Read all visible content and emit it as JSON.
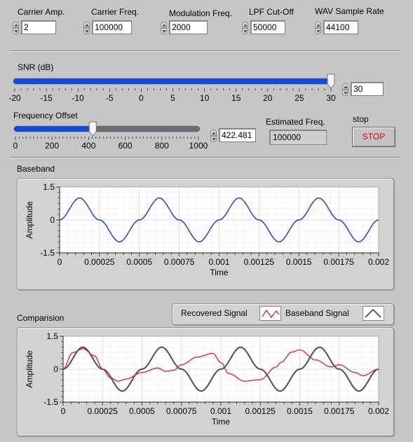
{
  "controls": {
    "carrier_amp": {
      "label": "Carrier Amp.",
      "value": "2"
    },
    "carrier_freq": {
      "label": "Carrier Freq.",
      "value": "100000"
    },
    "mod_freq": {
      "label": "Modulation Freq.",
      "value": "2000"
    },
    "lpf_cutoff": {
      "label": "LPF Cut-Off",
      "value": "50000"
    },
    "wav_rate": {
      "label": "WAV Sample Rate",
      "value": "44100"
    }
  },
  "snr": {
    "label": "SNR (dB)",
    "value": "30",
    "level": 30,
    "min": -20,
    "max": 30,
    "ticks": [
      "-20",
      "-15",
      "-10",
      "-5",
      "0",
      "5",
      "10",
      "15",
      "20",
      "25",
      "30"
    ]
  },
  "freq_offset": {
    "label": "Frequency Offset",
    "value": "422.481",
    "level": 422.481,
    "min": 0,
    "max": 1000,
    "ticks": [
      "0",
      "200",
      "400",
      "600",
      "800",
      "1000"
    ]
  },
  "estimated": {
    "label": "Estimated Freq.",
    "value": "100000"
  },
  "stop": {
    "label": "stop",
    "button": "STOP"
  },
  "colors": {
    "slider_fill": "#1747d6",
    "baseband_blue": "#1f44c8",
    "recovered_red": "#e01b1b",
    "baseband_gray": "#4d4d5c",
    "stop_red": "#e00000"
  },
  "chart_data": [
    {
      "type": "line",
      "title": "Baseband",
      "xlabel": "Time",
      "ylabel": "Amplitude",
      "xlim": [
        0,
        0.002
      ],
      "ylim": [
        -1.5,
        1.5
      ],
      "x_ticks": [
        "0",
        "0.00025",
        "0.0005",
        "0.00075",
        "0.001",
        "0.00125",
        "0.0015",
        "0.00175",
        "0.002"
      ],
      "y_ticks": [
        "1.5",
        "0",
        "-1.5"
      ],
      "grid": true,
      "series": [
        {
          "x": [
            0,
            0.000125,
            0.00025,
            0.000375,
            0.0005,
            0.000625,
            0.00075,
            0.000875,
            0.001,
            0.001125,
            0.00125,
            0.001375,
            0.0015,
            0.001625,
            0.00175,
            0.001875,
            0.002
          ],
          "values": [
            0,
            1,
            0,
            -1,
            0,
            1,
            0,
            -1,
            0,
            1,
            0,
            -1,
            0,
            1,
            0,
            -1,
            0
          ]
        }
      ]
    },
    {
      "type": "line",
      "title": "Comparision",
      "xlabel": "Time",
      "ylabel": "Amplitude",
      "xlim": [
        0,
        0.002
      ],
      "ylim": [
        -1.5,
        1.5
      ],
      "x_ticks": [
        "0",
        "0.00025",
        "0.0005",
        "0.00075",
        "0.001",
        "0.00125",
        "0.0015",
        "0.00175",
        "0.002"
      ],
      "y_ticks": [
        "1.5",
        "0",
        "-1.5"
      ],
      "grid": true,
      "legend": "top-right",
      "series": [
        {
          "name": "Recovered Signal",
          "x": [
            0,
            6e-05,
            0.000125,
            0.0002,
            0.00025,
            0.0003,
            0.00035,
            0.0004,
            0.0005,
            0.0006,
            0.00065,
            0.0007,
            0.00075,
            0.00085,
            0.00095,
            0.001,
            0.00105,
            0.00115,
            0.00125,
            0.00135,
            0.00138,
            0.00145,
            0.0015,
            0.0016,
            0.0017,
            0.00175,
            0.00185,
            0.0019,
            0.002
          ],
          "values": [
            0,
            0.75,
            0.93,
            0.6,
            0,
            -0.4,
            -0.55,
            -0.45,
            -0.15,
            0.05,
            -0.1,
            -0.05,
            0.2,
            0.55,
            0.72,
            0.3,
            -0.2,
            -0.55,
            -0.48,
            0.1,
            0.3,
            0.78,
            0.88,
            0.42,
            0.1,
            0.2,
            -0.15,
            -0.3,
            0
          ]
        },
        {
          "name": "Baseband Signal",
          "x": [
            0,
            0.000125,
            0.00025,
            0.000375,
            0.0005,
            0.000625,
            0.00075,
            0.000875,
            0.001,
            0.001125,
            0.00125,
            0.001375,
            0.0015,
            0.001625,
            0.00175,
            0.001875,
            0.002
          ],
          "values": [
            0,
            1,
            0,
            -1,
            0,
            1,
            0,
            -1,
            0,
            1,
            0,
            -1,
            0,
            1,
            0,
            -1,
            0
          ]
        }
      ]
    }
  ]
}
